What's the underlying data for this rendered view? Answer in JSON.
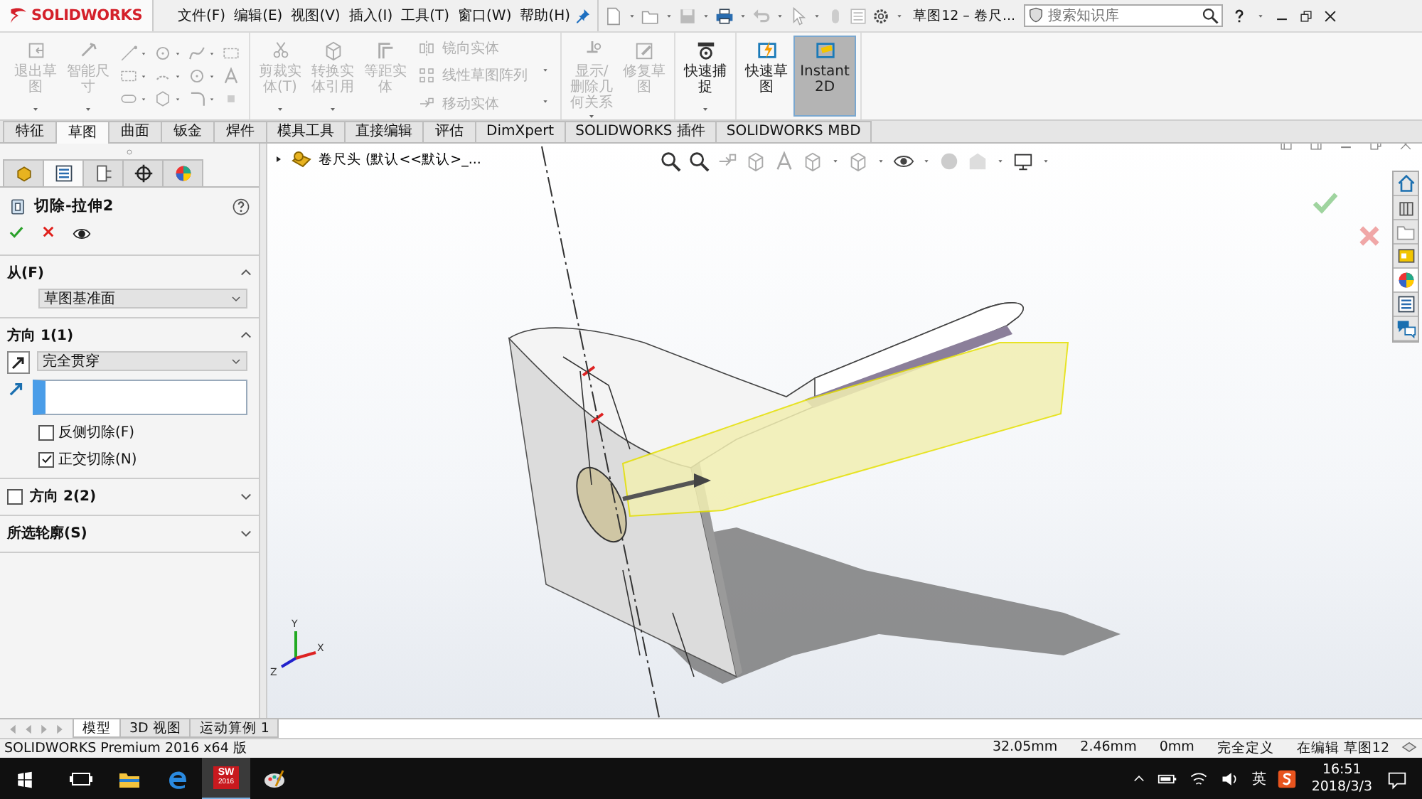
{
  "app": {
    "logo": "SOLIDWORKS",
    "menu": [
      "文件(F)",
      "编辑(E)",
      "视图(V)",
      "插入(I)",
      "工具(T)",
      "窗口(W)",
      "帮助(H)"
    ],
    "title": "草图12 – 卷尺...",
    "search": {
      "placeholder": "搜索知识库"
    }
  },
  "ribbon": {
    "groups": [
      {
        "items": [
          {
            "kind": "large",
            "label": "退出草图",
            "disabled": true,
            "selected": false,
            "has_menu": true
          },
          {
            "kind": "large",
            "label": "智能尺寸",
            "disabled": true,
            "selected": false,
            "has_menu": true
          },
          {
            "kind": "grid",
            "disabled": true
          }
        ]
      },
      {
        "items": [
          {
            "kind": "large",
            "label": "剪裁实体(T)",
            "disabled": true,
            "selected": false,
            "has_menu": true
          },
          {
            "kind": "large",
            "label": "转换实体引用",
            "disabled": true,
            "selected": false,
            "has_menu": true
          },
          {
            "kind": "large",
            "label": "等距实体",
            "disabled": true,
            "selected": false,
            "has_menu": false
          },
          {
            "kind": "list",
            "disabled": true,
            "labels": [
              "镜向实体",
              "线性草图阵列",
              "移动实体"
            ]
          }
        ]
      },
      {
        "items": [
          {
            "kind": "large",
            "label": "显示/删除几何关系",
            "disabled": true,
            "selected": false,
            "has_menu": true
          },
          {
            "kind": "large",
            "label": "修复草图",
            "disabled": true,
            "selected": false,
            "has_menu": false
          }
        ]
      },
      {
        "items": [
          {
            "kind": "large",
            "label": "快速捕捉",
            "disabled": false,
            "selected": false,
            "has_menu": true
          }
        ]
      },
      {
        "items": [
          {
            "kind": "large",
            "label": "快速草图",
            "disabled": false,
            "selected": false,
            "has_menu": false
          },
          {
            "kind": "large",
            "label": "Instant2D",
            "disabled": false,
            "selected": true,
            "has_menu": false
          }
        ]
      }
    ]
  },
  "command_tabs": [
    {
      "label": "特征",
      "selected": false
    },
    {
      "label": "草图",
      "selected": true
    },
    {
      "label": "曲面",
      "selected": false
    },
    {
      "label": "钣金",
      "selected": false
    },
    {
      "label": "焊件",
      "selected": false
    },
    {
      "label": "模具工具",
      "selected": false
    },
    {
      "label": "直接编辑",
      "selected": false
    },
    {
      "label": "评估",
      "selected": false
    },
    {
      "label": "DimXpert",
      "selected": false
    },
    {
      "label": "SOLIDWORKS 插件",
      "selected": false
    },
    {
      "label": "SOLIDWORKS MBD",
      "selected": false
    }
  ],
  "property_manager": {
    "tabs": [
      {
        "kind": "feature",
        "selected": false
      },
      {
        "kind": "property",
        "selected": true
      },
      {
        "kind": "config",
        "selected": false
      },
      {
        "kind": "dimxpert",
        "selected": false
      },
      {
        "kind": "display",
        "selected": false
      }
    ],
    "title": "切除-拉伸2",
    "sections": [
      {
        "kind": "from",
        "title": "从(F)",
        "expanded": true,
        "dropdown": "草图基准面"
      },
      {
        "kind": "direction",
        "title": "方向 1(1)",
        "expanded": true,
        "dropdown": "完全贯穿",
        "options": [
          {
            "label": "反侧切除(F)",
            "checked": false
          },
          {
            "label": "正交切除(N)",
            "checked": true
          }
        ]
      },
      {
        "kind": "optional",
        "title": "方向 2(2)",
        "expanded": false,
        "checked": false
      },
      {
        "kind": "plain",
        "title": "所选轮廓(S)",
        "expanded": false
      }
    ]
  },
  "viewport": {
    "breadcrumb": "卷尺头  (默认<<默认>_...",
    "triad": [
      "Y",
      "X",
      "Z"
    ],
    "task_pane": [
      {
        "kind": "home",
        "selected": false
      },
      {
        "kind": "library",
        "selected": false
      },
      {
        "kind": "folder",
        "selected": false
      },
      {
        "kind": "palette",
        "selected": false
      },
      {
        "kind": "appearance",
        "selected": true
      },
      {
        "kind": "properties",
        "selected": false
      },
      {
        "kind": "forum",
        "selected": false
      }
    ]
  },
  "model_tabs": [
    {
      "label": "模型",
      "selected": true
    },
    {
      "label": "3D 视图",
      "selected": false
    },
    {
      "label": "运动算例 1",
      "selected": false
    }
  ],
  "status_bar": {
    "product": "SOLIDWORKS Premium 2016 x64 版",
    "readouts": [
      "32.05mm",
      "2.46mm",
      "0mm",
      "完全定义",
      "在编辑 草图12"
    ]
  },
  "taskbar": {
    "apps": [
      {
        "kind": "task-view",
        "active": false
      },
      {
        "kind": "explorer",
        "active": false
      },
      {
        "kind": "edge",
        "active": false
      },
      {
        "kind": "solidworks",
        "label": "SW",
        "version": "2016",
        "active": true
      },
      {
        "kind": "paint",
        "active": false
      }
    ],
    "ime": "英",
    "time": "16:51",
    "date": "2018/3/3"
  }
}
